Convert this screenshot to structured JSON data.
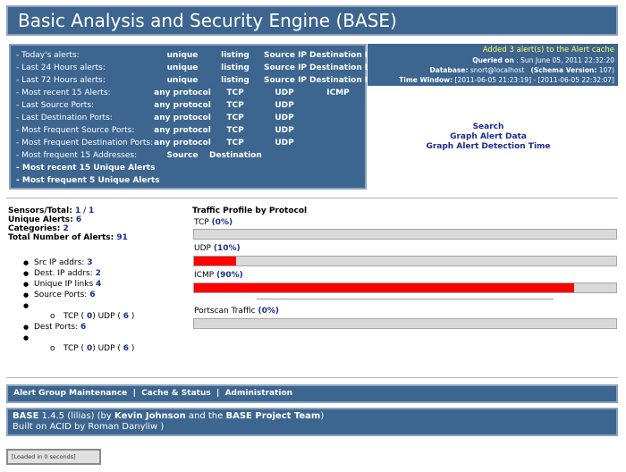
{
  "banner": {
    "title": "Basic Analysis and Security Engine (BASE)"
  },
  "menu": {
    "rows": [
      {
        "label": "- Today's alerts:",
        "cols": [
          "unique",
          "listing",
          "Source IP",
          "Destination IP"
        ]
      },
      {
        "label": "- Last 24 Hours alerts:",
        "cols": [
          "unique",
          "listing",
          "Source IP",
          "Destination IP"
        ]
      },
      {
        "label": "- Last 72 Hours alerts:",
        "cols": [
          "unique",
          "listing",
          "Source IP",
          "Destination IP"
        ]
      },
      {
        "label": "- Most recent 15 Alerts:",
        "cols": [
          "any protocol",
          "TCP",
          "UDP",
          "ICMP"
        ]
      },
      {
        "label": "- Last Source Ports:",
        "cols": [
          "any protocol",
          "TCP",
          "UDP"
        ]
      },
      {
        "label": "- Last Destination Ports:",
        "cols": [
          "any protocol",
          "TCP",
          "UDP"
        ]
      },
      {
        "label": "- Most Frequent Source Ports:",
        "cols": [
          "any protocol",
          "TCP",
          "UDP"
        ]
      },
      {
        "label": "- Most Frequent Destination Ports:",
        "cols": [
          "any protocol",
          "TCP",
          "UDP"
        ]
      },
      {
        "label": "- Most frequent 15 Addresses:",
        "cols": [
          "Source",
          "Destination"
        ]
      },
      {
        "label": "- Most recent 15 Unique Alerts",
        "cols": []
      },
      {
        "label": "- Most frequent 5 Unique Alerts",
        "cols": []
      }
    ]
  },
  "cache": {
    "added": "Added 3 alert(s) to the Alert cache",
    "queried_label": "Queried on",
    "queried_value": ": Sun June 05, 2011 22:32:20",
    "database_label": "Database:",
    "database_value": "snort@localhost",
    "schema_label": "(Schema Version:",
    "schema_value": "107)",
    "window_label": "Time Window:",
    "window_value": "[2011-06-05 21:23:19] - [2011-06-05 22:32:07]"
  },
  "links": {
    "search": "Search",
    "graph_data": "Graph Alert Data",
    "graph_time": "Graph Alert Detection Time"
  },
  "stats": {
    "sensors_label": "Sensors/Total:",
    "sensors_value": "1",
    "sensors_sep": " / ",
    "sensors_total": "1",
    "unique_label": "Unique Alerts:",
    "unique_value": "6",
    "categories_label": "Categories:",
    "categories_value": "2",
    "total_label": "Total Number of Alerts:",
    "total_value": "91"
  },
  "ip_list": {
    "src_label": "Src IP addrs:",
    "src_value": "3",
    "dst_label": "Dest. IP addrs:",
    "dst_value": "2",
    "links_label": "Unique IP links",
    "links_value": "4",
    "sport_label": "Source Ports:",
    "sport_value": "6",
    "tcp_label": "TCP (",
    "tcp_src": "0",
    "udp_label": ")  UDP (",
    "udp_src": "6",
    "close": ")",
    "dport_label": "Dest Ports:",
    "dport_value": "6",
    "tcp_dst": "0",
    "udp_dst": "6"
  },
  "profile": {
    "title": "Traffic Profile by Protocol",
    "tcp_label": "TCP",
    "tcp_pct": "(0%)",
    "tcp_value": 0,
    "udp_label": "UDP",
    "udp_pct": "(10%)",
    "udp_value": 10,
    "icmp_label": "ICMP",
    "icmp_pct": "(90%)",
    "icmp_value": 90,
    "portscan_label": "Portscan Traffic",
    "portscan_pct": "(0%)",
    "portscan_value": 0
  },
  "footer_nav": {
    "maintenance": "Alert Group Maintenance",
    "sep": "|",
    "cache": "Cache & Status",
    "admin": "Administration"
  },
  "credits": {
    "base": "BASE",
    "version": "1.4.5 (lilias) (by",
    "author": "Kevin Johnson",
    "and": "and the",
    "team": "BASE Project Team",
    "close": ")",
    "built": "Built on ACID by Roman Danyliw )"
  },
  "loaded": "[Loaded in 0 seconds]",
  "colors": {
    "panel": "#3c6590",
    "bar_fill": "#ff0000",
    "track": "#d9d9d9"
  }
}
